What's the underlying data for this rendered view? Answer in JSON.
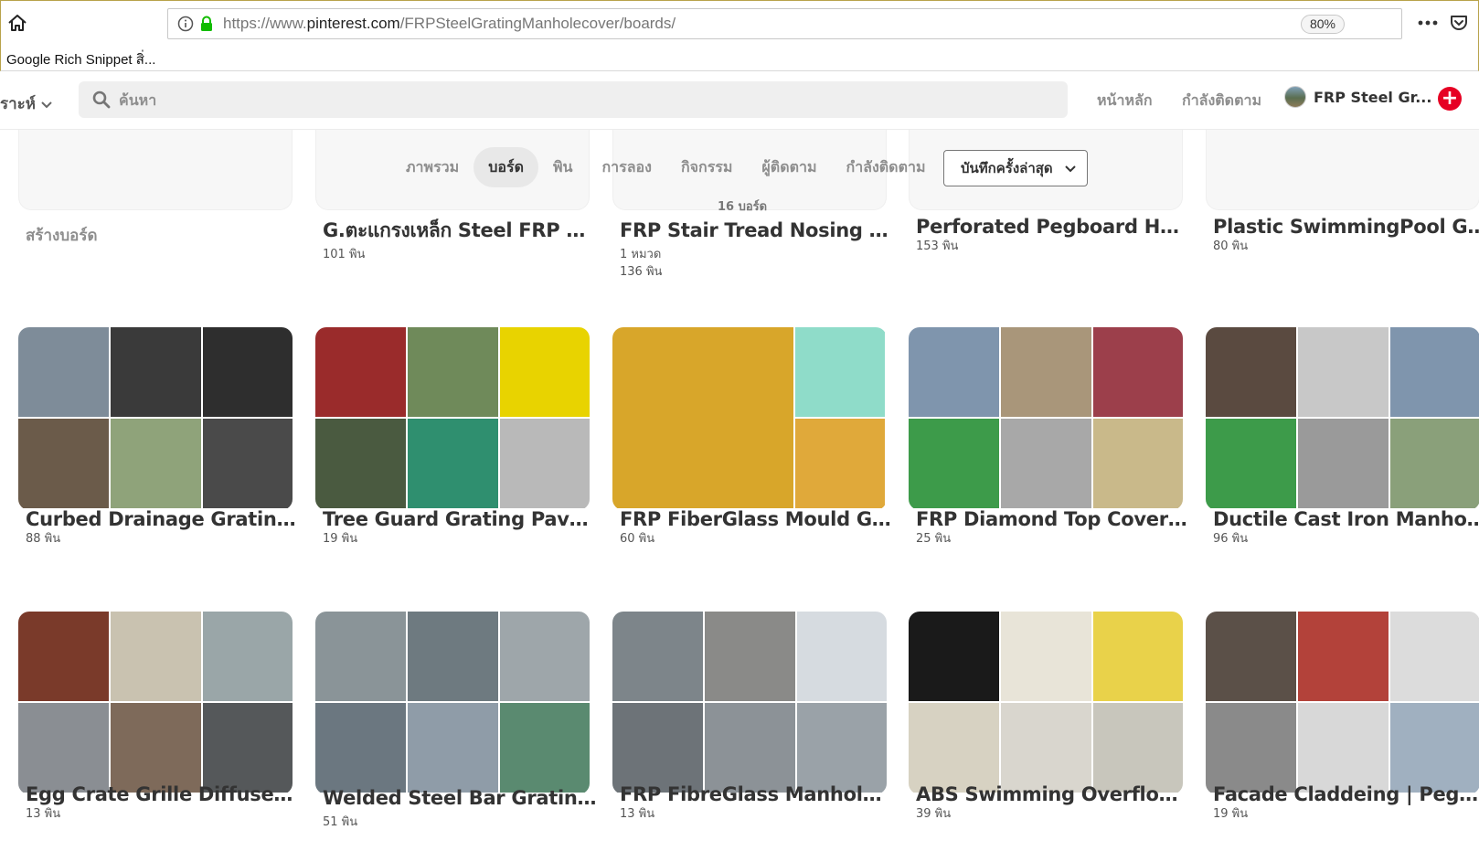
{
  "browser": {
    "url_prefix": "https://www.",
    "url_domain": "pinterest.com",
    "url_path": "/FRPSteelGratingManholecover/boards/",
    "zoom": "80%",
    "bookmark": "Google Rich Snippet สิ่..."
  },
  "header": {
    "category_dropdown": "ราะห์",
    "search_placeholder": "ค้นหา",
    "nav_home": "หน้าหลัก",
    "nav_following": "กำลังติดตาม",
    "profile_name": "FRP Steel Gr...",
    "add_symbol": "+"
  },
  "subtabs": {
    "items": [
      "ภาพรวม",
      "บอร์ด",
      "พิน",
      "การลอง",
      "กิจกรรม",
      "ผู้ติดตาม",
      "กำลังติดตาม"
    ],
    "active_index": 1,
    "sort_label": "บันทึกครั้งล่าสุด",
    "boards_count": "16 บอร์ด"
  },
  "create_board": "สร้างบอร์ด",
  "rows": [
    [
      {
        "title": "G.ตะแกรงเหล็ก Steel FRP Gr...",
        "meta": [
          "101 พิน"
        ]
      },
      {
        "title": "FRP Stair Tread Nosing #แผ่...",
        "meta": [
          "1 หมวด",
          "136 พิน"
        ]
      },
      {
        "title": "Perforated Pegboard Hook ...",
        "meta": [
          "153 พิน"
        ]
      },
      {
        "title": "Plastic SwimmingPool Grati...",
        "meta": [
          "80 พิน"
        ]
      }
    ],
    [
      {
        "title": "Curbed Drainage Grating Sc...",
        "meta": [
          "88 พิน"
        ]
      },
      {
        "title": "Tree Guard Grating Paver Fr...",
        "meta": [
          "19 พิน"
        ]
      },
      {
        "title": "FRP FiberGlass Mould Grati...",
        "meta": [
          "60 พิน"
        ]
      },
      {
        "title": "FRP Diamond Top Cover (S...",
        "meta": [
          "25 พิน"
        ]
      },
      {
        "title": "Ductile Cast Iron Manhole C...",
        "meta": [
          "96 พิน"
        ]
      }
    ],
    [
      {
        "title": "Egg Crate Grille Diffuser Di...",
        "meta": [
          "13 พิน"
        ]
      },
      {
        "title": "Welded Steel Bar Grating ต...",
        "meta": [
          "51 พิน"
        ]
      },
      {
        "title": "FRP FibreGlass Manhole Co...",
        "meta": [
          "13 พิน"
        ]
      },
      {
        "title": "ABS Swimming Overflow D...",
        "meta": [
          "39 พิน"
        ]
      },
      {
        "title": "Facade Claddeing | Pegboar...",
        "meta": [
          "19 พิน"
        ]
      }
    ]
  ],
  "colors": {
    "pinterest_red": "#e60023",
    "text_dark": "#333333",
    "text_muted": "#8e8e8e"
  }
}
